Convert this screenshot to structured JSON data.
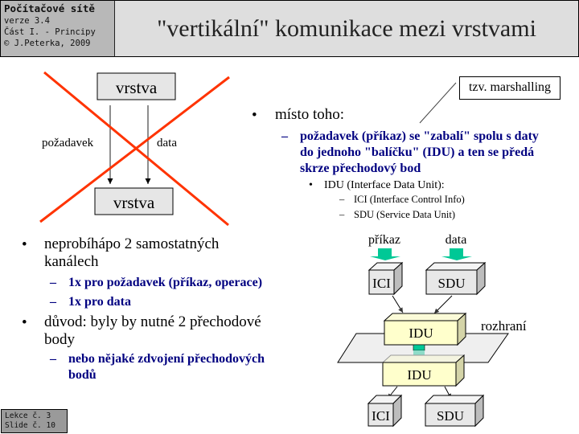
{
  "header": {
    "course_title": "Počítačové sítě",
    "version": "verze 3.4",
    "part": "Část I. - Principy",
    "copyright": "© J.Peterka, 2009",
    "slide_title": "\"vertikální\" komunikace mezi vrstvami"
  },
  "footer": {
    "lesson": "Lekce č. 3",
    "slide": "Slide č. 10"
  },
  "crossed_diagram": {
    "top_layer": "vrstva",
    "bottom_layer": "vrstva",
    "left_label": "požadavek",
    "right_label": "data",
    "cross_color": "#ff3300"
  },
  "callout": {
    "text": "tzv. marshalling"
  },
  "right_text": {
    "bullet": "místo toho:",
    "sub": "požadavek (příkaz) se \"zabalí\" spolu s daty do jednoho \"balíčku\" (IDU) a ten se předá skrze přechodový bod",
    "idu": "IDU (Interface Data Unit):",
    "ici": "ICI (Interface  Control Info)",
    "sdu": "SDU (Service Data Unit)"
  },
  "left_text": {
    "bullet1": "neprobíhápo 2 samostatných kanálech",
    "sub1": "1x pro požadavek (příkaz, operace)",
    "sub2": "1x pro data",
    "bullet2": "důvod: byly by nutné 2 přechodové body",
    "sub3": "nebo nějaké zdvojení přechodových bodů"
  },
  "idu_diagram": {
    "label_command": "příkaz",
    "label_data": "data",
    "ici_top": "ICI",
    "sdu_top": "SDU",
    "idu_top": "IDU",
    "interface_label": "rozhraní",
    "idu_bottom": "IDU",
    "ici_bottom": "ICI",
    "sdu_bottom": "SDU"
  },
  "bullets": {
    "dot": "•",
    "dash": "–"
  },
  "colors": {
    "accent_blue": "#000080",
    "arrow_green": "#00c896",
    "idu_fill": "#ffffcc",
    "box_fill": "#e8e8e8"
  }
}
